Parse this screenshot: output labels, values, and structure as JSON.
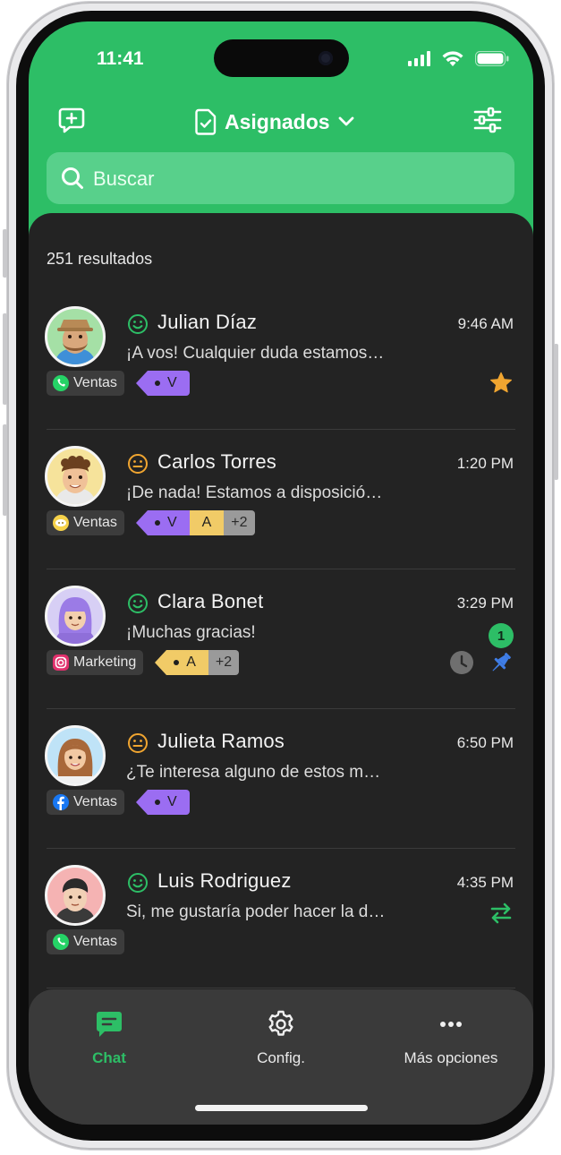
{
  "status_bar": {
    "time": "11:41"
  },
  "header": {
    "title": "Asignados"
  },
  "search": {
    "placeholder": "Buscar"
  },
  "results_count": "251 resultados",
  "conversations": [
    {
      "name": "Julian Díaz",
      "time": "9:46 AM",
      "preview": "¡A vos! Cualquier duda estamos…",
      "sentiment": "happy",
      "channel": {
        "name": "Ventas",
        "icon": "whatsapp-icon"
      },
      "tags": [
        "V"
      ],
      "extra_tags": "",
      "status_icons": [
        "star-icon"
      ]
    },
    {
      "name": "Carlos Torres",
      "time": "1:20 PM",
      "preview": "¡De nada! Estamos a disposició…",
      "sentiment": "neutral",
      "channel": {
        "name": "Ventas",
        "icon": "chat-widget-icon"
      },
      "tags": [
        "V",
        "A"
      ],
      "extra_tags": "+2",
      "status_icons": []
    },
    {
      "name": "Clara Bonet",
      "time": "3:29 PM",
      "preview": "¡Muchas gracias!",
      "sentiment": "happy",
      "channel": {
        "name": "Marketing",
        "icon": "instagram-icon"
      },
      "tags": [
        "A"
      ],
      "extra_tags": "+2",
      "unread": "1",
      "status_icons": [
        "clock-icon",
        "pin-icon"
      ]
    },
    {
      "name": "Julieta Ramos",
      "time": "6:50 PM",
      "preview": "¿Te interesa alguno de estos m…",
      "sentiment": "neutral",
      "channel": {
        "name": "Ventas",
        "icon": "facebook-icon"
      },
      "tags": [
        "V"
      ],
      "extra_tags": "",
      "status_icons": []
    },
    {
      "name": "Luis Rodriguez",
      "time": "4:35 PM",
      "preview": "Si, me gustaría poder hacer la d…",
      "sentiment": "happy",
      "channel": {
        "name": "Ventas",
        "icon": "whatsapp-icon"
      },
      "tags": [],
      "extra_tags": "",
      "status_icons": [
        "transfer-icon"
      ]
    }
  ],
  "tabbar": {
    "chat": "Chat",
    "config": "Config.",
    "more": "Más opciones"
  },
  "colors": {
    "brand_green": "#2dbe66",
    "background": "#232323",
    "tag_v": "#9b6df2",
    "tag_a": "#f1cb67",
    "star": "#f0a530",
    "pin": "#3f7de6",
    "neutral_face": "#f0a530"
  }
}
